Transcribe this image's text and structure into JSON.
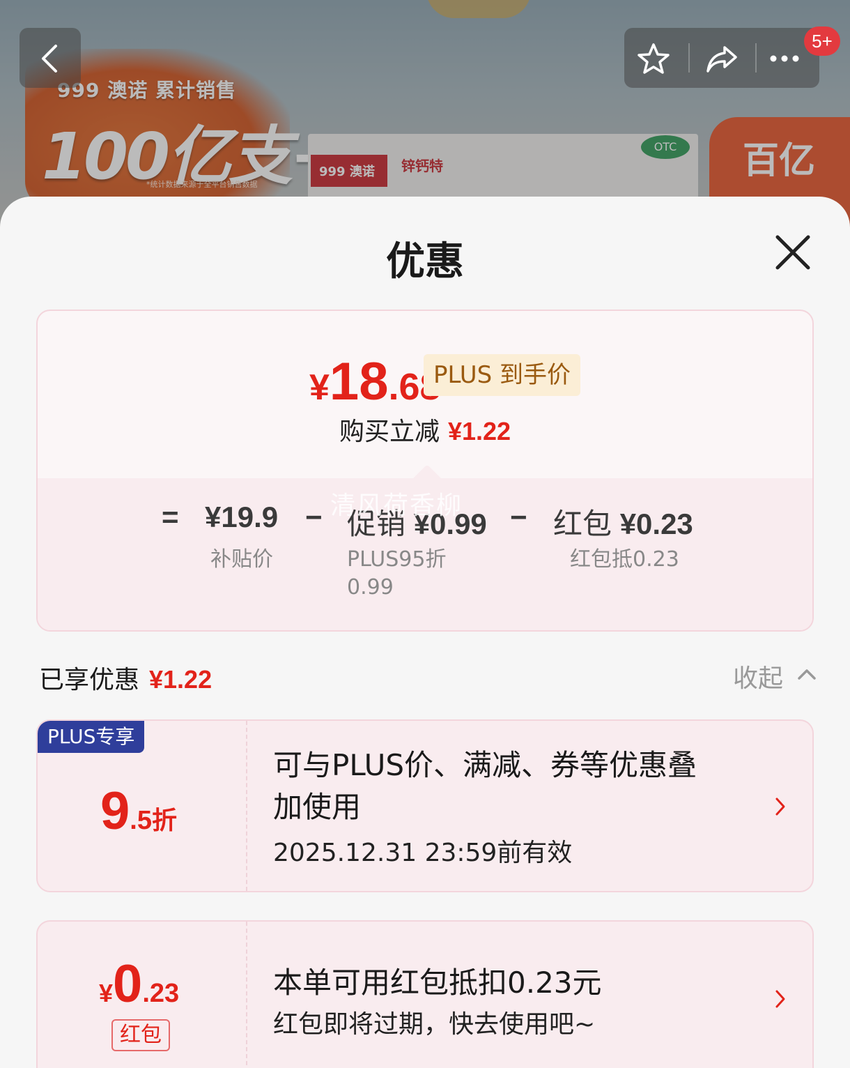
{
  "banner": {
    "brand_text": "999 澳诺 累计销售",
    "big_text": "100亿支+",
    "note_text": "*统计数据来源于全平台销售数据",
    "product_brand": "999 澳诺",
    "product_name": "锌钙特",
    "otc_label": "OTC",
    "subsidy_text": "百亿"
  },
  "nav": {
    "badge_count": "5+"
  },
  "sheet": {
    "title": "优惠"
  },
  "summary": {
    "final_price_currency": "¥",
    "final_price_int": "18",
    "final_price_dec": ".68",
    "plus_label": "PLUS 到手价",
    "reduce_label": "购买立减",
    "reduce_amount": "¥1.22",
    "eq": "=",
    "subsidy_price": "¥19.9",
    "minus1": "−",
    "promo_label": "促销",
    "promo_amount": "¥0.99",
    "minus2": "−",
    "redpacket_label": "红包",
    "redpacket_amount": "¥0.23",
    "subsidy_caption": "补贴价",
    "promo_caption_1": "PLUS95折",
    "promo_caption_2": "0.99",
    "redpacket_caption": "红包抵0.23",
    "watermark": "清风荷香柳"
  },
  "enjoyed": {
    "label": "已享优惠",
    "amount": "¥1.22",
    "collapse_label": "收起"
  },
  "cards": [
    {
      "ribbon": "PLUS专享",
      "value_big": "9",
      "value_small": ".5",
      "value_unit": "折",
      "line1": "可与PLUS价、满减、券等优惠叠",
      "line2": "加使用",
      "line3": "2025.12.31 23:59前有效"
    },
    {
      "currency": "¥",
      "value_big": "0",
      "value_small": ".23",
      "tag": "红包",
      "line1": "本单可用红包抵扣0.23元",
      "line2": "红包即将过期，快去使用吧~"
    }
  ],
  "colors": {
    "accent_red": "#e2231a",
    "plus_blue": "#2f3e9b",
    "plus_tag_bg": "#fbeed6"
  }
}
